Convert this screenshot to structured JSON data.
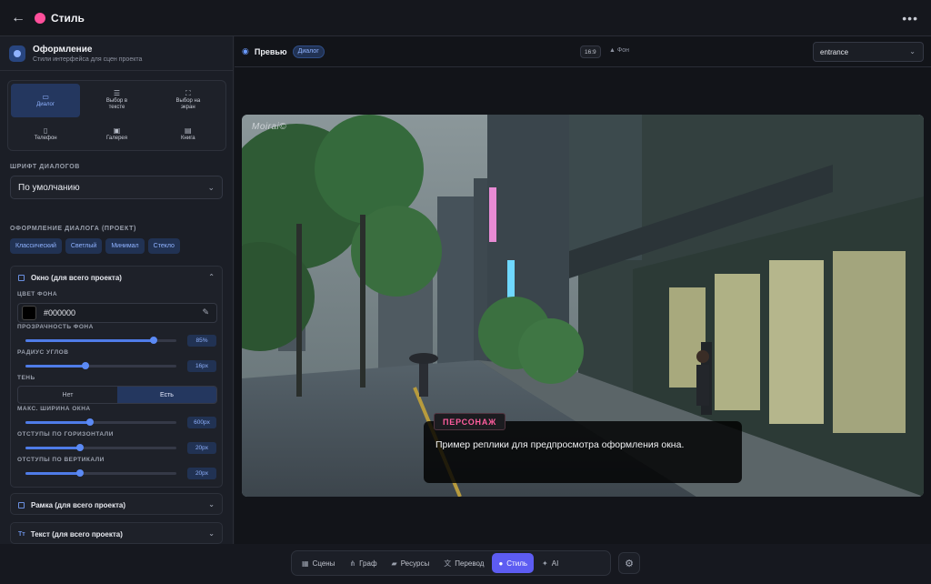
{
  "header": {
    "title": "Стиль",
    "back_icon": "arrow-left-icon",
    "menu_icon": "more-horizontal-icon"
  },
  "sidebar": {
    "title": "Оформление",
    "subtitle": "Стили интерфейса для сцен проекта",
    "modes": [
      {
        "label": "Диалог",
        "icon": "chat-icon",
        "active": true
      },
      {
        "label": "Выбор в тексте",
        "icon": "list-icon",
        "active": false
      },
      {
        "label": "Выбор на экран",
        "icon": "fullscreen-icon",
        "active": false
      },
      {
        "label": "Телефон",
        "icon": "phone-icon",
        "active": false
      },
      {
        "label": "Галерея",
        "icon": "gallery-icon",
        "active": false
      },
      {
        "label": "Книга",
        "icon": "book-icon",
        "active": false
      }
    ],
    "font_label": "ШРИФТ ДИАЛОГОВ",
    "font_value": "По умолчанию",
    "dialog_style_label": "ОФОРМЛЕНИЕ ДИАЛОГА (ПРОЕКТ)",
    "presets": [
      "Классический",
      "Светлый",
      "Минимал",
      "Стекло"
    ],
    "window_panel": {
      "title": "Окно (для всего проекта)",
      "bg_color_label": "ЦВЕТ ФОНА",
      "bg_color": "#000000",
      "opacity_label": "ПРОЗРАЧНОСТЬ ФОНА",
      "opacity_value": "85%",
      "opacity_level": 0.85,
      "radius_label": "РАДИУС УГЛОВ",
      "radius_value": "16px",
      "radius_level": 0.4,
      "shadow_label": "ТЕНЬ",
      "shadow_off": "Нет",
      "shadow_on": "Есть",
      "width_label": "МАКС. ШИРИНА ОКНА",
      "width_value": "600px",
      "width_level": 0.43,
      "hpad_label": "ОТСТУПЫ ПО ГОРИЗОНТАЛИ",
      "hpad_value": "20px",
      "hpad_level": 0.36,
      "vpad_label": "ОТСТУПЫ ПО ВЕРТИКАЛИ",
      "vpad_value": "20px",
      "vpad_level": 0.36
    },
    "frame_panel_title": "Рамка (для всего проекта)",
    "text_panel_title": "Текст (для всего проекта)",
    "text_panel_prefix": "Tт"
  },
  "preview": {
    "label": "Превью",
    "badge": "Диалог",
    "ratio": "16:9",
    "bg_label": "Фон",
    "scene": "entrance",
    "watermark": "Moirai©",
    "speaker": "ПЕРСОНАЖ",
    "line": "Пример реплики для предпросмотра оформления окна."
  },
  "dock": {
    "tabs": [
      {
        "label": "Сцены",
        "icon": "grid-icon",
        "active": false
      },
      {
        "label": "Граф",
        "icon": "graph-icon",
        "active": false
      },
      {
        "label": "Ресурсы",
        "icon": "folder-icon",
        "active": false
      },
      {
        "label": "Перевод",
        "icon": "translate-icon",
        "active": false
      },
      {
        "label": "Стиль",
        "icon": "palette-icon",
        "active": true
      },
      {
        "label": "AI",
        "icon": "sparkle-icon",
        "active": false
      }
    ],
    "settings_icon": "gear-icon"
  },
  "colors": {
    "accent": "#4f7ce8",
    "active_tab": "#5d5cf2",
    "speaker": "#ff5d9e",
    "background": "#16181f"
  }
}
